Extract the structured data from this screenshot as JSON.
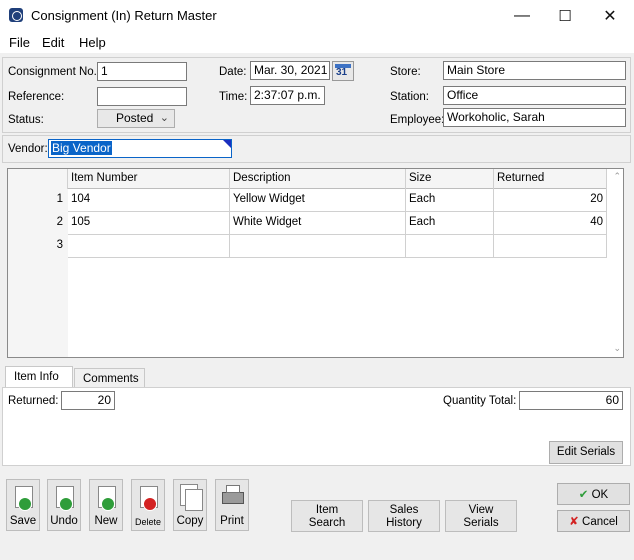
{
  "window": {
    "title": "Consignment (In) Return Master",
    "minimize": "—",
    "maximize": "☐",
    "close": "✕"
  },
  "menu": [
    "File",
    "Edit",
    "Help"
  ],
  "header": {
    "consignment_no_label": "Consignment No.:",
    "consignment_no": "1",
    "reference_label": "Reference:",
    "reference": "",
    "status_label": "Status:",
    "status": "Posted",
    "date_label": "Date:",
    "date": "Mar. 30, 2021",
    "calendar_glyph": "31",
    "time_label": "Time:",
    "time": "2:37:07 p.m.",
    "store_label": "Store:",
    "store": "Main Store",
    "station_label": "Station:",
    "station": "Office",
    "employee_label": "Employee:",
    "employee": "Workoholic, Sarah"
  },
  "vendor": {
    "label": "Vendor:",
    "value": "Big Vendor"
  },
  "grid": {
    "columns": [
      "Item Number",
      "Description",
      "Size",
      "Returned"
    ],
    "rows": [
      {
        "num": "1",
        "item": "104",
        "desc": "Yellow Widget",
        "size": "Each",
        "returned": "20"
      },
      {
        "num": "2",
        "item": "105",
        "desc": "White Widget",
        "size": "Each",
        "returned": "40"
      },
      {
        "num": "3",
        "item": "",
        "desc": "",
        "size": "",
        "returned": ""
      }
    ]
  },
  "tabs": {
    "item_info": "Item Info",
    "comments": "Comments",
    "returned_label": "Returned:",
    "returned_value": "20",
    "qty_total_label": "Quantity Total:",
    "qty_total_value": "60",
    "edit_serials": "Edit Serials"
  },
  "toolbar": {
    "save": "Save",
    "undo": "Undo",
    "new": "New",
    "delete": "Delete",
    "copy": "Copy",
    "print": "Print"
  },
  "nav": {
    "item_search_1": "Item",
    "item_search_2": "Search",
    "sales_history_1": "Sales",
    "sales_history_2": "History",
    "view_serials_1": "View",
    "view_serials_2": "Serials"
  },
  "dialog": {
    "ok": "OK",
    "cancel": "Cancel"
  }
}
